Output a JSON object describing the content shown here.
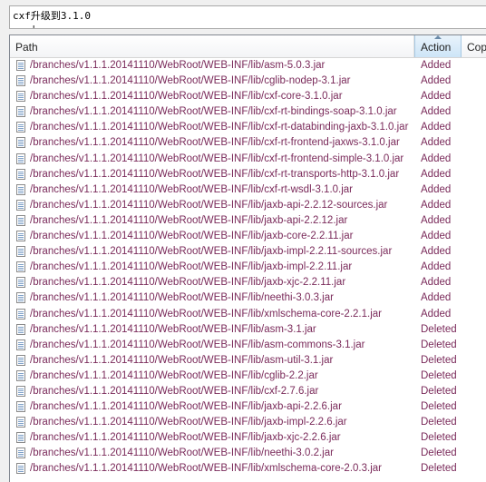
{
  "commit_message": {
    "line1": "cxf升级到3.1.0",
    "line2": "...'..."
  },
  "columns": {
    "path": "Path",
    "action": "Action",
    "copy": "Copy"
  },
  "files": [
    {
      "path": "/branches/v1.1.1.20141110/WebRoot/WEB-INF/lib/asm-5.0.3.jar",
      "action": "Added"
    },
    {
      "path": "/branches/v1.1.1.20141110/WebRoot/WEB-INF/lib/cglib-nodep-3.1.jar",
      "action": "Added"
    },
    {
      "path": "/branches/v1.1.1.20141110/WebRoot/WEB-INF/lib/cxf-core-3.1.0.jar",
      "action": "Added"
    },
    {
      "path": "/branches/v1.1.1.20141110/WebRoot/WEB-INF/lib/cxf-rt-bindings-soap-3.1.0.jar",
      "action": "Added"
    },
    {
      "path": "/branches/v1.1.1.20141110/WebRoot/WEB-INF/lib/cxf-rt-databinding-jaxb-3.1.0.jar",
      "action": "Added"
    },
    {
      "path": "/branches/v1.1.1.20141110/WebRoot/WEB-INF/lib/cxf-rt-frontend-jaxws-3.1.0.jar",
      "action": "Added"
    },
    {
      "path": "/branches/v1.1.1.20141110/WebRoot/WEB-INF/lib/cxf-rt-frontend-simple-3.1.0.jar",
      "action": "Added"
    },
    {
      "path": "/branches/v1.1.1.20141110/WebRoot/WEB-INF/lib/cxf-rt-transports-http-3.1.0.jar",
      "action": "Added"
    },
    {
      "path": "/branches/v1.1.1.20141110/WebRoot/WEB-INF/lib/cxf-rt-wsdl-3.1.0.jar",
      "action": "Added"
    },
    {
      "path": "/branches/v1.1.1.20141110/WebRoot/WEB-INF/lib/jaxb-api-2.2.12-sources.jar",
      "action": "Added"
    },
    {
      "path": "/branches/v1.1.1.20141110/WebRoot/WEB-INF/lib/jaxb-api-2.2.12.jar",
      "action": "Added"
    },
    {
      "path": "/branches/v1.1.1.20141110/WebRoot/WEB-INF/lib/jaxb-core-2.2.11.jar",
      "action": "Added"
    },
    {
      "path": "/branches/v1.1.1.20141110/WebRoot/WEB-INF/lib/jaxb-impl-2.2.11-sources.jar",
      "action": "Added"
    },
    {
      "path": "/branches/v1.1.1.20141110/WebRoot/WEB-INF/lib/jaxb-impl-2.2.11.jar",
      "action": "Added"
    },
    {
      "path": "/branches/v1.1.1.20141110/WebRoot/WEB-INF/lib/jaxb-xjc-2.2.11.jar",
      "action": "Added"
    },
    {
      "path": "/branches/v1.1.1.20141110/WebRoot/WEB-INF/lib/neethi-3.0.3.jar",
      "action": "Added"
    },
    {
      "path": "/branches/v1.1.1.20141110/WebRoot/WEB-INF/lib/xmlschema-core-2.2.1.jar",
      "action": "Added"
    },
    {
      "path": "/branches/v1.1.1.20141110/WebRoot/WEB-INF/lib/asm-3.1.jar",
      "action": "Deleted"
    },
    {
      "path": "/branches/v1.1.1.20141110/WebRoot/WEB-INF/lib/asm-commons-3.1.jar",
      "action": "Deleted"
    },
    {
      "path": "/branches/v1.1.1.20141110/WebRoot/WEB-INF/lib/asm-util-3.1.jar",
      "action": "Deleted"
    },
    {
      "path": "/branches/v1.1.1.20141110/WebRoot/WEB-INF/lib/cglib-2.2.jar",
      "action": "Deleted"
    },
    {
      "path": "/branches/v1.1.1.20141110/WebRoot/WEB-INF/lib/cxf-2.7.6.jar",
      "action": "Deleted"
    },
    {
      "path": "/branches/v1.1.1.20141110/WebRoot/WEB-INF/lib/jaxb-api-2.2.6.jar",
      "action": "Deleted"
    },
    {
      "path": "/branches/v1.1.1.20141110/WebRoot/WEB-INF/lib/jaxb-impl-2.2.6.jar",
      "action": "Deleted"
    },
    {
      "path": "/branches/v1.1.1.20141110/WebRoot/WEB-INF/lib/jaxb-xjc-2.2.6.jar",
      "action": "Deleted"
    },
    {
      "path": "/branches/v1.1.1.20141110/WebRoot/WEB-INF/lib/neethi-3.0.2.jar",
      "action": "Deleted"
    },
    {
      "path": "/branches/v1.1.1.20141110/WebRoot/WEB-INF/lib/xmlschema-core-2.0.3.jar",
      "action": "Deleted"
    }
  ]
}
